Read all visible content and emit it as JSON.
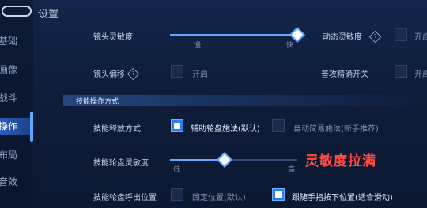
{
  "page_title": "设置",
  "sidebar": {
    "items": [
      {
        "label": "基础",
        "active": false
      },
      {
        "label": "画像",
        "active": false
      },
      {
        "label": "战斗",
        "active": false
      },
      {
        "label": "操作",
        "active": true
      },
      {
        "label": "布局",
        "active": false
      },
      {
        "label": "音效",
        "active": false
      }
    ]
  },
  "camera_sensitivity": {
    "label": "镜头灵敏度",
    "min_label": "慢",
    "max_label": "快",
    "level": 1.0
  },
  "dynamic_sensitivity": {
    "label": "动态灵敏度",
    "state_label": "开启",
    "checked": false
  },
  "camera_offset": {
    "label": "镜头偏移",
    "state_label": "开启",
    "checked": false
  },
  "normal_attack_precision": {
    "label": "普攻精确开关",
    "state_label": "开启",
    "checked": false
  },
  "section_header": "技能操作方式",
  "skill_release": {
    "label": "技能释放方式",
    "options": [
      {
        "label": "辅助轮盘施法(默认)",
        "checked": true
      },
      {
        "label": "自动简易施法(新手推荐)",
        "checked": false
      }
    ]
  },
  "skill_wheel_sensitivity": {
    "label": "技能轮盘灵敏度",
    "min_label": "低",
    "max_label": "高",
    "level": 0.4
  },
  "skill_wheel_position": {
    "label": "技能轮盘呼出位置",
    "options": [
      {
        "label": "固定位置(默认)",
        "checked": false
      },
      {
        "label": "跟随手指按下位置(适合滑动)",
        "checked": true
      }
    ]
  },
  "annotation": "灵敏度拉满",
  "colors": {
    "accent": "#5ea6ff",
    "background": "#0f1f3c",
    "annotation": "#ff4a43"
  }
}
